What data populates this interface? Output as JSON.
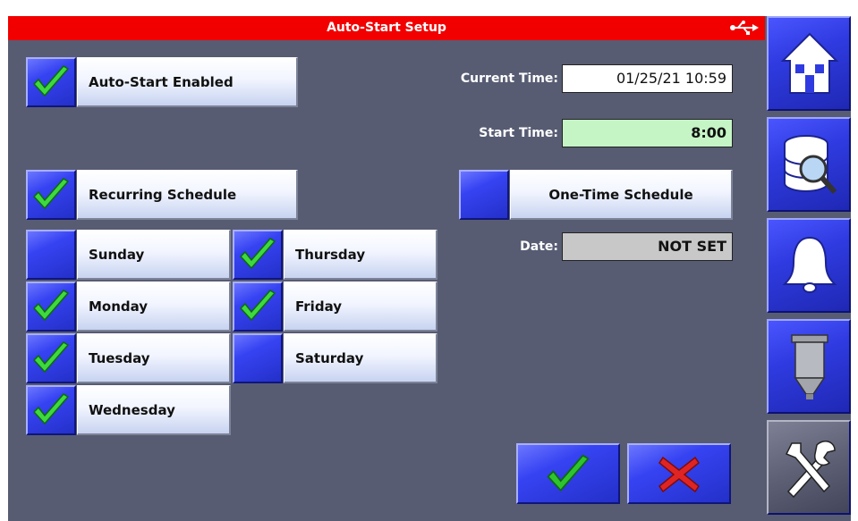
{
  "header": {
    "title": "Auto-Start Setup",
    "usb_icon": "usb-icon"
  },
  "auto_start": {
    "label": "Auto-Start Enabled",
    "checked": true
  },
  "current_time": {
    "label": "Current Time:",
    "value": "01/25/21 10:59"
  },
  "start_time": {
    "label": "Start Time:",
    "value": "8:00"
  },
  "recurring": {
    "label": "Recurring Schedule",
    "checked": true
  },
  "one_time": {
    "label": "One-Time Schedule",
    "checked": false
  },
  "date": {
    "label": "Date:",
    "value": "NOT SET"
  },
  "days": {
    "sunday": {
      "label": "Sunday",
      "checked": false
    },
    "monday": {
      "label": "Monday",
      "checked": true
    },
    "tuesday": {
      "label": "Tuesday",
      "checked": true
    },
    "wednesday": {
      "label": "Wednesday",
      "checked": true
    },
    "thursday": {
      "label": "Thursday",
      "checked": true
    },
    "friday": {
      "label": "Friday",
      "checked": true
    },
    "saturday": {
      "label": "Saturday",
      "checked": false
    }
  },
  "actions": {
    "confirm_icon": "checkmark-icon",
    "cancel_icon": "x-icon"
  },
  "sidebar": {
    "items": [
      {
        "icon": "home-icon"
      },
      {
        "icon": "database-search-icon"
      },
      {
        "icon": "bell-icon"
      },
      {
        "icon": "tank-icon"
      },
      {
        "icon": "tools-icon"
      }
    ]
  },
  "colors": {
    "title_bar": "#f20000",
    "background": "#575c73",
    "accent_blue": "#3643f2",
    "start_time_field": "#c5f5c5",
    "date_field": "#c8c8c8",
    "check_green": "#2fc42f",
    "cancel_red": "#e02424"
  }
}
